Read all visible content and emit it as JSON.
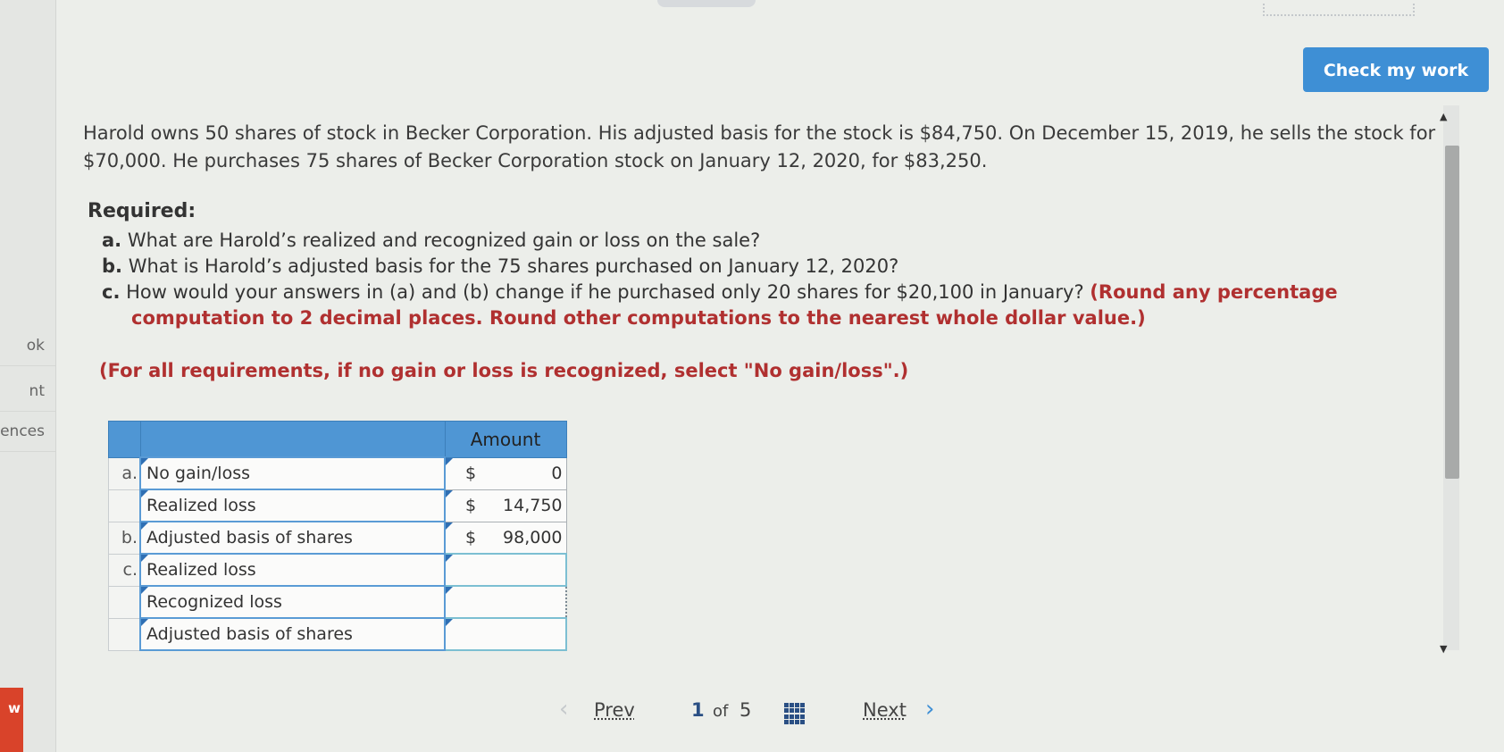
{
  "toolbar": {
    "check_label": "Check my work"
  },
  "sidebar": {
    "items": [
      {
        "label": "ok"
      },
      {
        "label": "nt"
      },
      {
        "label": "ences"
      }
    ],
    "badge": "w"
  },
  "question": {
    "text": "Harold owns 50 shares of stock in Becker Corporation. His adjusted basis for the stock is $84,750. On December 15, 2019, he sells the stock for $70,000. He purchases 75 shares of Becker Corporation stock on January 12, 2020, for $83,250."
  },
  "required": {
    "title": "Required:",
    "a_label": "a.",
    "a_text": "What are Harold’s realized and recognized gain or loss on the sale?",
    "b_label": "b.",
    "b_text": "What is Harold’s adjusted basis for the 75 shares purchased on January 12, 2020?",
    "c_label": "c.",
    "c_text": "How would your answers in (a) and (b) change if he purchased only 20 shares for $20,100 in January?",
    "c_round_1": "(Round any percentage",
    "c_round_2": "computation to 2 decimal places. Round other computations to the nearest whole dollar value.)",
    "all_note": "(For all requirements, if no gain or loss is recognized, select \"No gain/loss\".)"
  },
  "table": {
    "header_amount": "Amount",
    "rows": [
      {
        "letter": "a.",
        "label": "No gain/loss",
        "dollar": "$",
        "value": "0"
      },
      {
        "letter": "",
        "label": "Realized loss",
        "dollar": "$",
        "value": "14,750"
      },
      {
        "letter": "b.",
        "label": "Adjusted basis of shares",
        "dollar": "$",
        "value": "98,000"
      },
      {
        "letter": "c.",
        "label": "Realized loss",
        "dollar": "",
        "value": ""
      },
      {
        "letter": "",
        "label": "Recognized loss",
        "dollar": "",
        "value": ""
      },
      {
        "letter": "",
        "label": "Adjusted basis of shares",
        "dollar": "",
        "value": ""
      }
    ]
  },
  "pager": {
    "prev": "Prev",
    "current": "1",
    "of": "of",
    "total": "5",
    "next": "Next"
  }
}
